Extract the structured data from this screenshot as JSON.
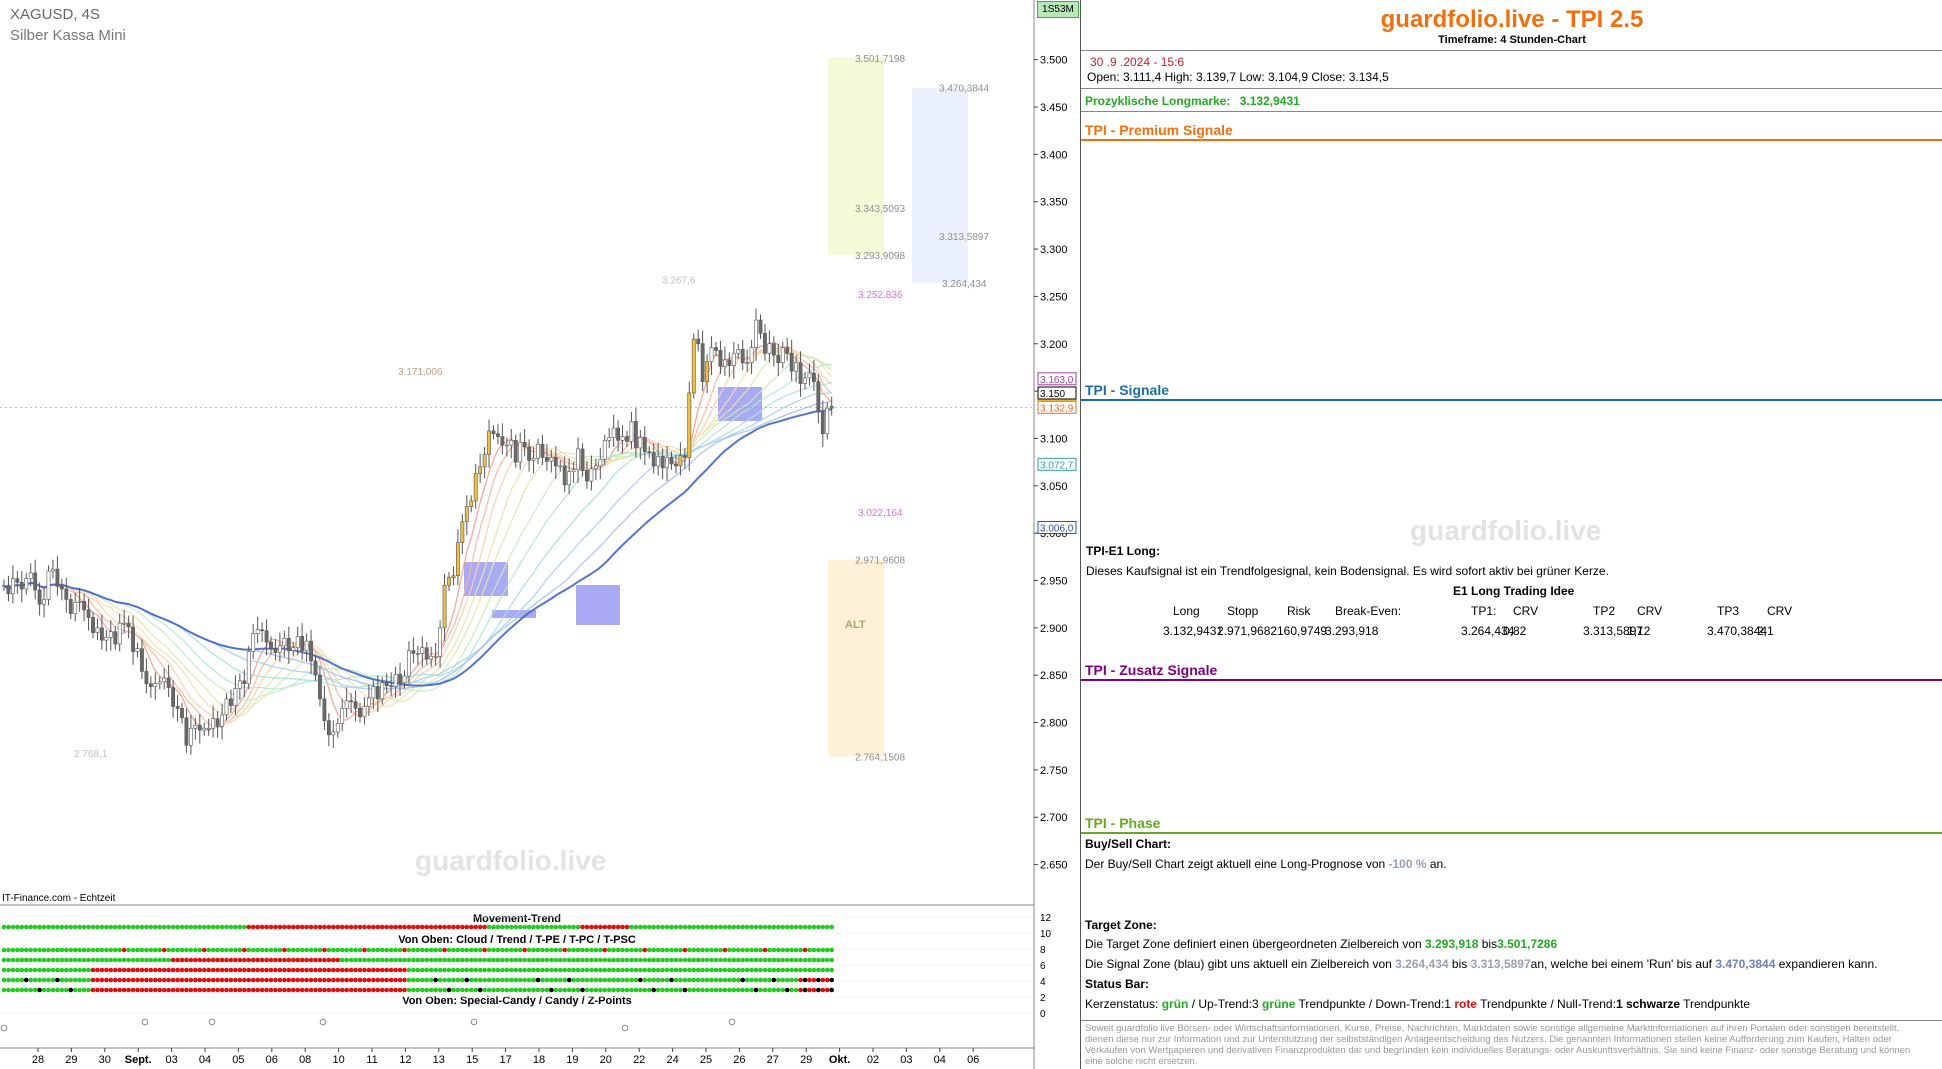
{
  "header": {
    "symbol": "XAGUSD, 4S",
    "name": "Silber Kassa Mini",
    "source": "IT-Finance.com - Echtzeit",
    "interval_button": "1S53M"
  },
  "watermark": "guardfolio.live",
  "chart_data": {
    "type": "candlestick",
    "ylim": [
      2.62,
      3.525
    ],
    "y_ticks": [
      "3.500",
      "3.450",
      "3.400",
      "3.350",
      "3.300",
      "3.250",
      "3.200",
      "3.150",
      "3.100",
      "3.050",
      "3.000",
      "2.950",
      "2.900",
      "2.850",
      "2.800",
      "2.750",
      "2.700",
      "2.650"
    ],
    "x_labels": [
      "28",
      "29",
      "30",
      "Sept.",
      "03",
      "04",
      "05",
      "06",
      "08",
      "10",
      "11",
      "12",
      "13",
      "15",
      "17",
      "18",
      "19",
      "20",
      "22",
      "24",
      "25",
      "26",
      "27",
      "29",
      "Okt.",
      "02",
      "03",
      "04",
      "06"
    ],
    "closes": [
      2.945,
      2.936,
      2.952,
      2.948,
      2.941,
      2.952,
      2.958,
      2.94,
      2.925,
      2.93,
      2.96,
      2.962,
      2.944,
      2.941,
      2.93,
      2.915,
      2.927,
      2.928,
      2.919,
      2.911,
      2.895,
      2.9,
      2.887,
      2.89,
      2.896,
      2.883,
      2.905,
      2.905,
      2.901,
      2.875,
      2.878,
      2.854,
      2.841,
      2.838,
      2.841,
      2.843,
      2.847,
      2.837,
      2.817,
      2.815,
      2.805,
      2.776,
      2.794,
      2.797,
      2.792,
      2.794,
      2.794,
      2.804,
      2.796,
      2.808,
      2.825,
      2.818,
      2.836,
      2.844,
      2.841,
      2.875,
      2.894,
      2.898,
      2.897,
      2.885,
      2.878,
      2.874,
      2.881,
      2.889,
      2.876,
      2.879,
      2.891,
      2.876,
      2.886,
      2.865,
      2.85,
      2.825,
      2.802,
      2.787,
      2.79,
      2.799,
      2.815,
      2.823,
      2.822,
      2.815,
      2.806,
      2.817,
      2.826,
      2.838,
      2.825,
      2.842,
      2.839,
      2.838,
      2.851,
      2.842,
      2.849,
      2.876,
      2.873,
      2.873,
      2.879,
      2.867,
      2.87,
      2.87,
      2.9,
      2.945,
      2.953,
      2.955,
      2.99,
      3.012,
      3.028,
      3.034,
      3.063,
      3.07,
      3.083,
      3.108,
      3.105,
      3.102,
      3.093,
      3.093,
      3.098,
      3.075,
      3.096,
      3.091,
      3.077,
      3.079,
      3.094,
      3.08,
      3.076,
      3.08,
      3.071,
      3.071,
      3.051,
      3.065,
      3.067,
      3.089,
      3.066,
      3.055,
      3.068,
      3.071,
      3.078,
      3.098,
      3.101,
      3.111,
      3.098,
      3.102,
      3.097,
      3.118,
      3.09,
      3.101,
      3.086,
      3.085,
      3.071,
      3.081,
      3.069,
      3.08,
      3.073,
      3.071,
      3.082,
      3.08,
      3.148,
      3.205,
      3.2,
      3.16,
      3.181,
      3.196,
      3.193,
      3.176,
      3.183,
      3.177,
      3.19,
      3.194,
      3.18,
      3.18,
      3.196,
      3.225,
      3.211,
      3.19,
      3.2,
      3.188,
      3.18,
      3.196,
      3.19,
      3.171,
      3.18,
      3.158,
      3.164,
      3.169,
      3.16,
      3.128,
      3.105,
      3.132,
      3.134
    ],
    "entry_marker": {
      "label": "Prozyklische Longmarke",
      "value": 3.1329431
    },
    "target_zone": {
      "from": 3.293918,
      "to": 3.5017286
    },
    "signal_zone": {
      "from": 3.264434,
      "to": 3.4703844
    },
    "alt_zone": {
      "label": "ALT",
      "from": 2.7641508,
      "to": 2.9719608
    },
    "price_labels": [
      {
        "text": "3.501,7198",
        "value": 3.5017
      },
      {
        "text": "3.470,3844",
        "value": 3.4704
      },
      {
        "text": "3.343,5093",
        "value": 3.3435
      },
      {
        "text": "3.313,5897",
        "value": 3.3136
      },
      {
        "text": "3.293,9098",
        "value": 3.2939
      },
      {
        "text": "3.264,434",
        "value": 3.2644
      },
      {
        "text": "3.252,836",
        "value": 3.2528
      },
      {
        "text": "3.267,6",
        "value": 3.2676
      },
      {
        "text": "3.171,006",
        "value": 3.171
      },
      {
        "text": "3.022,164",
        "value": 3.0222
      },
      {
        "text": "2.971,9608",
        "value": 2.972
      },
      {
        "text": "2.764,1508",
        "value": 2.7642
      },
      {
        "text": "2.768,1",
        "value": 2.7681
      }
    ],
    "axis_badges": [
      {
        "text": "3.163,0",
        "value": 3.163,
        "color": "#a040a0"
      },
      {
        "text": "3.150",
        "value": 3.148,
        "color": "#000000"
      },
      {
        "text": "3.134,3",
        "value": 3.1343,
        "color": "#f0c020"
      },
      {
        "text": "3.132,9",
        "value": 3.1329,
        "color": "#e07030"
      },
      {
        "text": "3.072,7",
        "value": 3.0727,
        "color": "#30a0a0"
      },
      {
        "text": "3.006,0",
        "value": 3.006,
        "color": "#3050c0"
      }
    ],
    "indicator": {
      "title": "Movement-Trend",
      "subtitle1": "Von Oben: Cloud / Trend / T-PE / T-PC / T-PSC",
      "subtitle2": "Von Oben: Special-Candy / Candy / Z-Points",
      "y_ticks": [
        "12",
        "10",
        "8",
        "6",
        "4",
        "2",
        "0"
      ]
    }
  },
  "panel": {
    "title": "guardfolio.live - TPI 2.5",
    "timeframe": "Timeframe: 4 Stunden-Chart",
    "datetime": "30 .9 .2024 - 15:6",
    "ohlc": "Open:  3.111,4     High:  3.139,7      Low:   3.104,9      Close:  3.134,5",
    "longmarke_label": "Prozyklische Longmarke:",
    "longmarke_value": "3.132,9431",
    "sec_premium": "TPI - Premium Signale",
    "sec_signale": "TPI - Signale",
    "e1_title": "TPI-E1 Long:",
    "e1_text": "Dieses Kaufsignal ist ein Trendfolgesignal, kein Bodensignal. Es wird sofort aktiv bei grüner Kerze.",
    "e1_table_title": "E1 Long Trading Idee",
    "e1_headers": [
      "Long",
      "Stopp",
      "Risk",
      "Break-Even:",
      "TP1:",
      "CRV",
      "TP2",
      "CRV",
      "TP3",
      "CRV"
    ],
    "e1_values": [
      "3.132,9431",
      "2.971,9682",
      "160,9749",
      "3.293,918",
      "3.264,434",
      "0,82",
      "3.313,5897",
      "1,12",
      "3.470,3844",
      "2,1"
    ],
    "sec_zusatz": "TPI - Zusatz Signale",
    "sec_phase": "TPI - Phase",
    "buysell_title": "Buy/Sell Chart:",
    "buysell_pre": "Der Buy/Sell Chart zeigt aktuell eine Long-Prognose von ",
    "buysell_value": "-100 %",
    "buysell_post": " an.",
    "target_title": "Target Zone:",
    "target_pre": "Die Target Zone definiert einen übergeordneten Zielbereich von ",
    "target_from": "3.293,918",
    "target_mid": "  bis",
    "target_to": "3.501,7286",
    "signal_pre": "Die Signal Zone (blau) gibt uns aktuell ein Zielbereich von ",
    "signal_from": "3.264,434",
    "signal_mid": "  bis ",
    "signal_to": "3.313,5897",
    "signal_post": "an, welche bei einem 'Run' bis auf ",
    "signal_run": "3.470,3844",
    "signal_end": " expandieren kann.",
    "status_title": "Status Bar:",
    "status_k": "Kerzenstatus:   ",
    "status_k_val": "grün",
    "status_up": "     / Up-Trend:3 ",
    "status_up_col": "grüne",
    "status_up2": " Trendpunkte  / Down-Trend:1 ",
    "status_down_col": "rote",
    "status_down2": " Trendpunkte / Null-Trend:",
    "status_null": "1 schwarze",
    "status_null2": " Trendpunkte",
    "disclaimer": "Soweit guardfolio live Börsen- oder Wirtschaftsinformationen, Kurse, Preise, Nachrichten, Marktdaten sowie sonstige allgemeine Marktinformationen auf ihren Portalen oder sonstigen bereitstellt, dienen diese nur zur Information und zur Unterstützung der selbstständigen Anlageentscheidung des Nutzers. Die genannten Informationen stellen keine Aufforderung zum Kaufen, Halten oder Verkaufen von Wertpapieren und derivativen Finanzprodukten dar und begründen kein individuelles Beratungs- oder Auskunftsverhältnis. Sie sind keine Finanz- oder sonstige Beratung und können eine solche nicht ersetzen."
  },
  "colors": {
    "brand": "#f07010",
    "premium": "#f07010",
    "signale": "#1a6fa0",
    "zusatz": "#800080",
    "phase": "#66aa22"
  }
}
